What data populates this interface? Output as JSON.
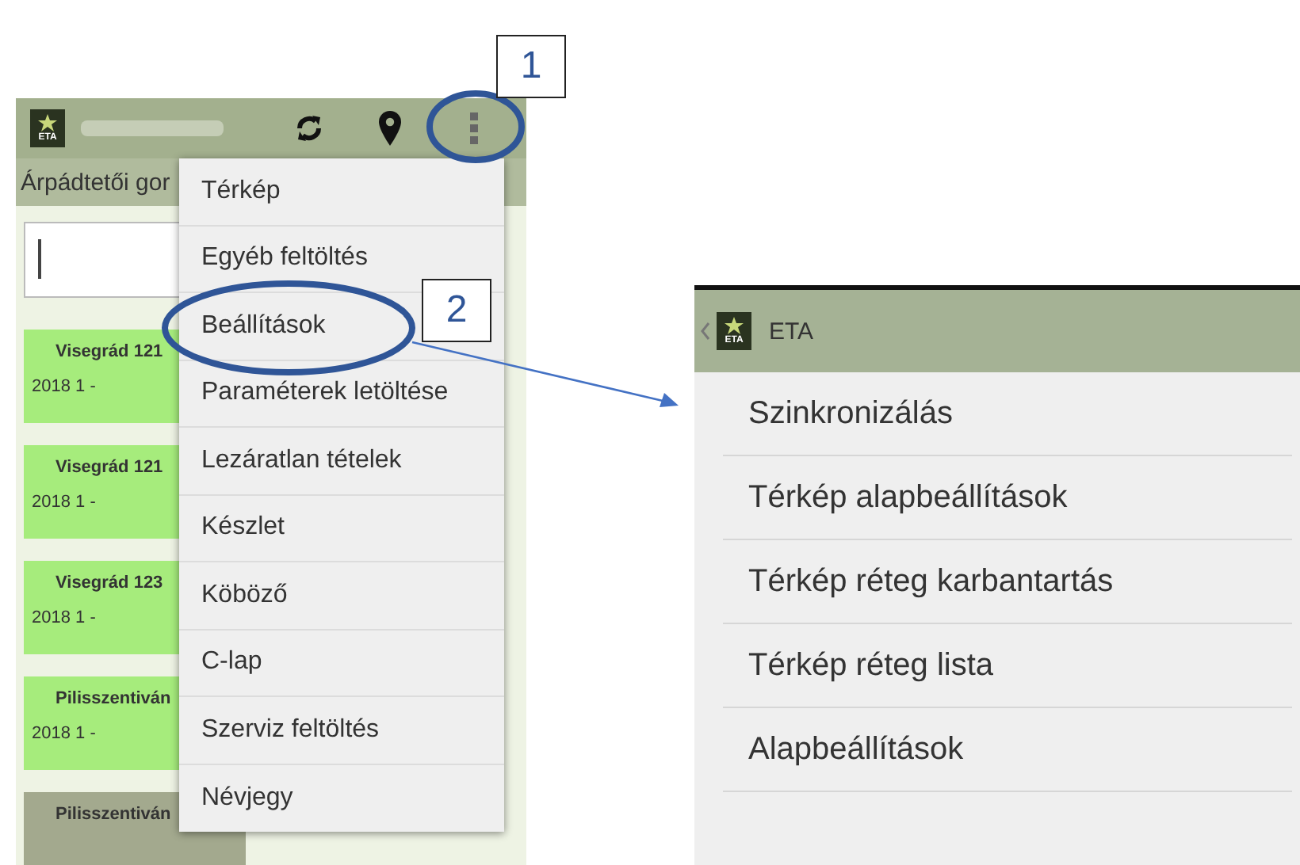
{
  "annotations": [
    {
      "number": "1"
    },
    {
      "number": "2"
    }
  ],
  "main_screen": {
    "logo_text": "ETA",
    "subheader": "Árpádtetői gor",
    "cards": [
      {
        "title": "Visegrád 121",
        "subtitle": "2018 1 -",
        "highlighted": true
      },
      {
        "title": "Visegrád 121",
        "subtitle": "2018 1 -",
        "highlighted": true
      },
      {
        "title": "Visegrád 123",
        "subtitle": "2018 1 -",
        "highlighted": true
      },
      {
        "title": "Pilisszentiván",
        "subtitle": "2018 1 -",
        "highlighted": true
      },
      {
        "title": "Pilisszentiván",
        "highlighted": false
      }
    ],
    "menu": [
      "Térkép",
      "Egyéb feltöltés",
      "Beállítások",
      "Paraméterek letöltése",
      "Lezáratlan tételek",
      "Készlet",
      "Köböző",
      "C-lap",
      "Szerviz feltöltés",
      "Névjegy"
    ]
  },
  "settings_screen": {
    "logo_text": "ETA",
    "title": "ETA",
    "items": [
      "Szinkronizálás",
      "Térkép alapbeállítások",
      "Térkép réteg karbantartás",
      "Térkép réteg lista",
      "Alapbeállítások"
    ]
  }
}
